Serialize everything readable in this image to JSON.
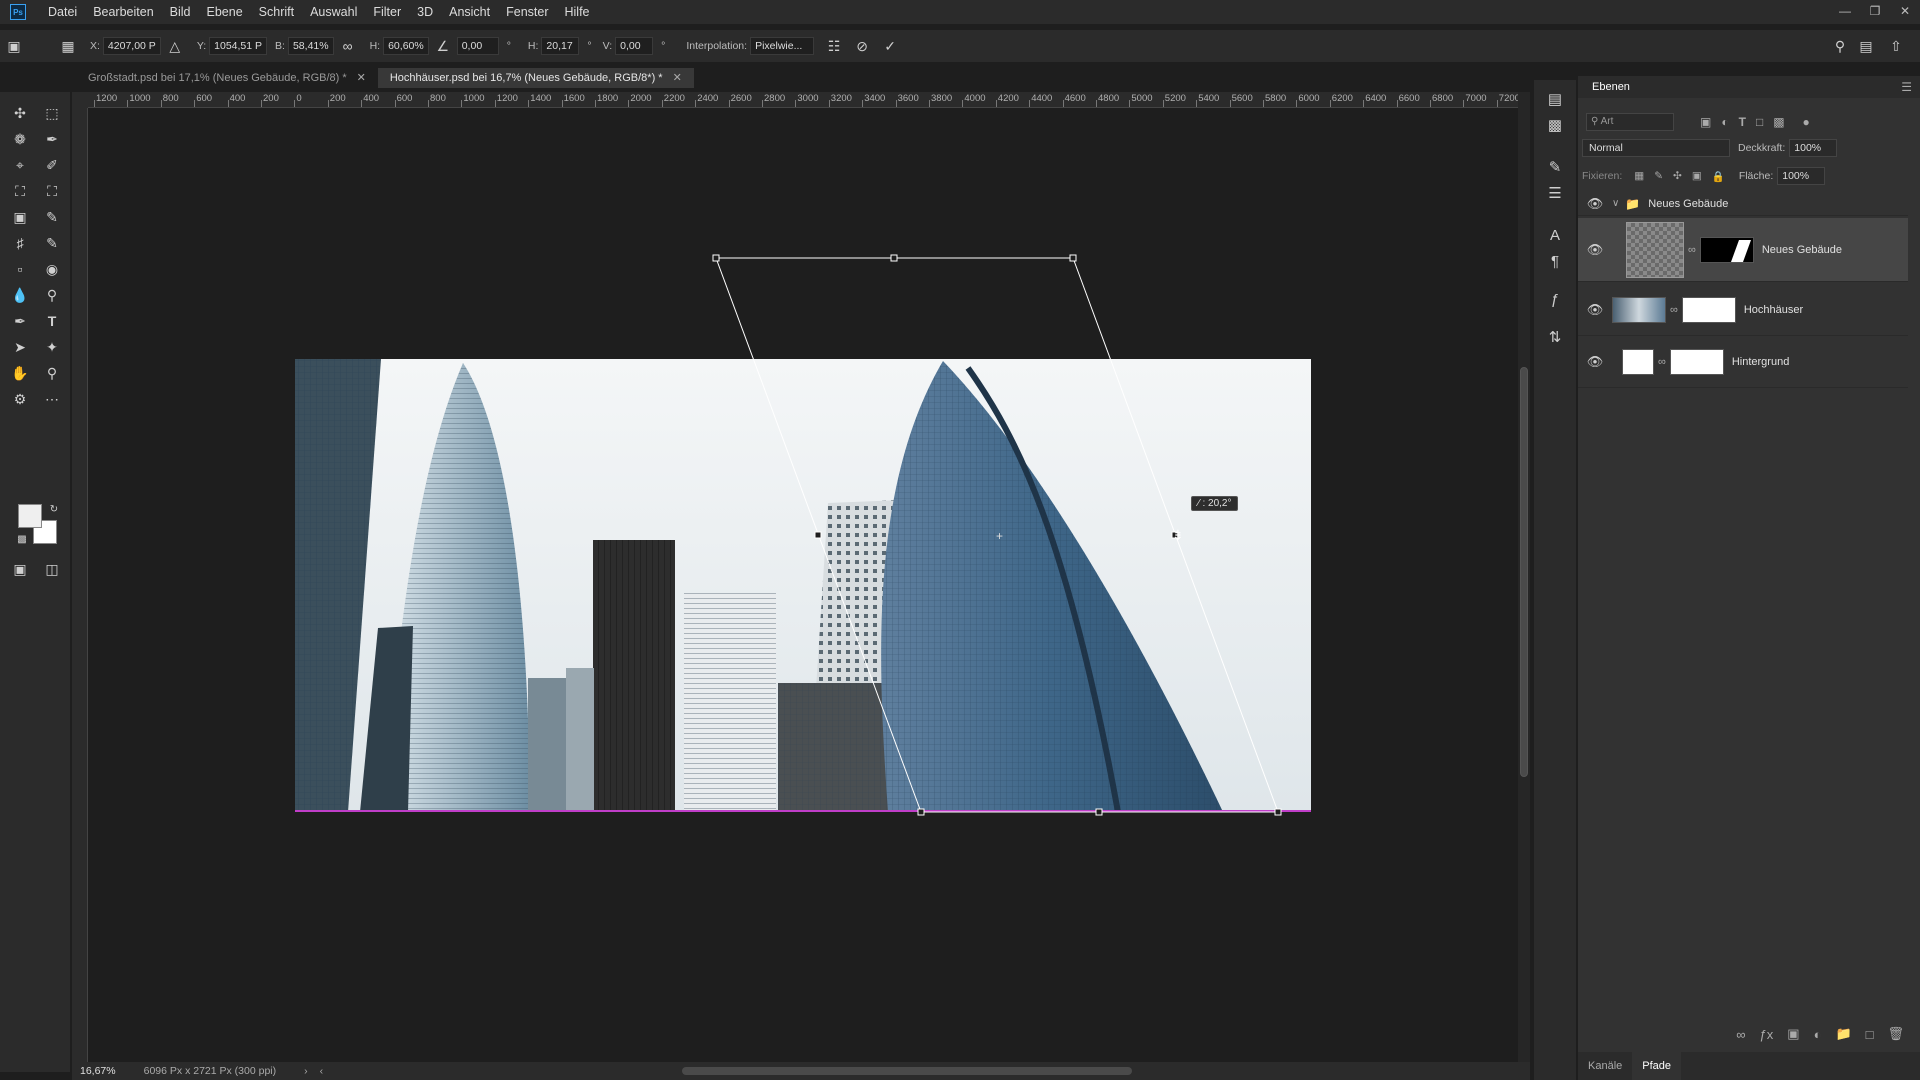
{
  "menu": [
    "Datei",
    "Bearbeiten",
    "Bild",
    "Ebene",
    "Schrift",
    "Auswahl",
    "Filter",
    "3D",
    "Ansicht",
    "Fenster",
    "Hilfe"
  ],
  "options": {
    "x_label": "X:",
    "x_value": "4207,00 P",
    "y_label": "Y:",
    "y_value": "1054,51 P",
    "b_label": "B:",
    "b_value": "58,41%",
    "h_label": "H:",
    "h_value": "60,60%",
    "angle_value": "0,00",
    "hskew_label": "H:",
    "hskew_value": "20,17",
    "vskew_label": "V:",
    "vskew_value": "0,00",
    "interp_label": "Interpolation:",
    "interp_value": "Pixelwie..."
  },
  "tabs": [
    {
      "label": "Großstadt.psd bei 17,1% (Neues Gebäude, RGB/8) *"
    },
    {
      "label": "Hochhäuser.psd bei 16,7% (Neues Gebäude, RGB/8*) *"
    }
  ],
  "ruler": [
    "1200",
    "1000",
    "800",
    "600",
    "400",
    "200",
    "0",
    "200",
    "400",
    "600",
    "800",
    "1000",
    "1200",
    "1400",
    "1600",
    "1800",
    "2000",
    "2200",
    "2400",
    "2600",
    "2800",
    "3000",
    "3200",
    "3400",
    "3600",
    "3800",
    "4000",
    "4200",
    "4400",
    "4600",
    "4800",
    "5000",
    "5200",
    "5400",
    "5600",
    "5800",
    "6000",
    "6200",
    "6400",
    "6600",
    "6800",
    "7000",
    "7200"
  ],
  "skew_tooltip": "⁄ : 20,2°",
  "status": {
    "zoom": "16,67%",
    "doc_info": "6096 Px x 2721 Px (300 ppi)"
  },
  "layers_panel": {
    "tab": "Ebenen",
    "filter_placeholder": "Art",
    "blend_mode": "Normal",
    "opacity_label": "Deckkraft:",
    "opacity_value": "100%",
    "lock_label": "Fixieren:",
    "fill_label": "Fläche:",
    "fill_value": "100%",
    "group_name": "Neues Gebäude",
    "layers": [
      {
        "name": "Neues Gebäude"
      },
      {
        "name": "Hochhäuser"
      },
      {
        "name": "Hintergrund"
      }
    ]
  },
  "footer_tabs": [
    "Kanäle",
    "Pfade"
  ],
  "colors": {
    "accent": "#3aa0f0",
    "chrome": "#2b2b2b",
    "panel": "#323232",
    "canvas_bg": "#1e1e1e"
  }
}
